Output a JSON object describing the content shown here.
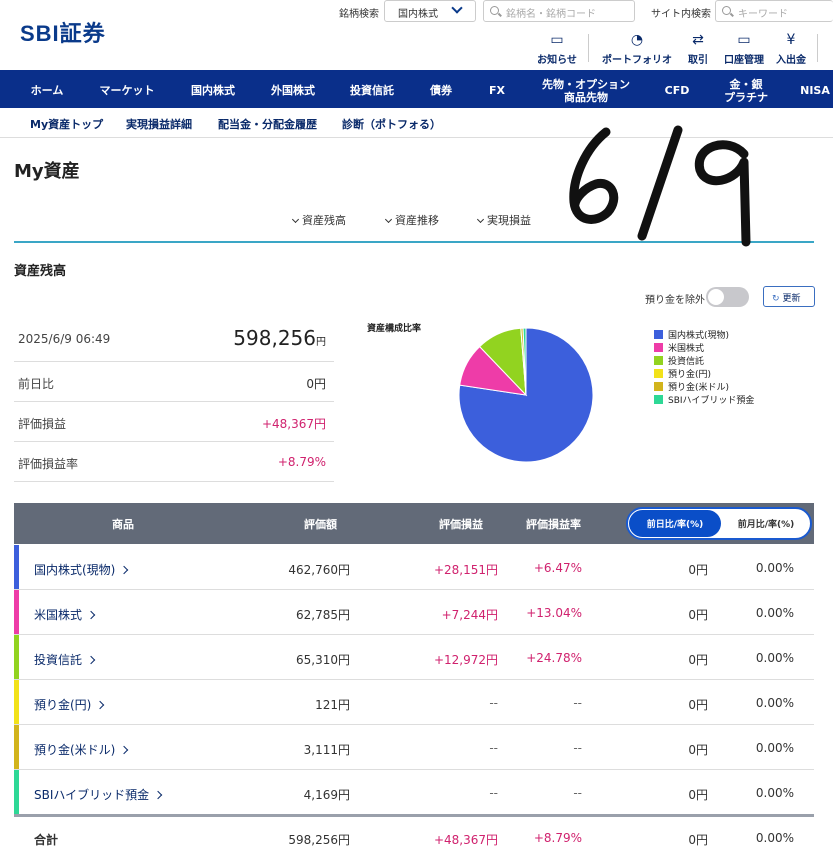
{
  "header": {
    "logo": "SBI証券",
    "ticker_search_label": "銘柄検索",
    "market_select": "国内株式",
    "ticker_placeholder": "銘柄名・銘柄コード",
    "site_search_label": "サイト内検索",
    "site_placeholder": "キーワード",
    "icons": [
      {
        "label": "お知らせ",
        "icon": "chat-icon"
      },
      {
        "label": "ポートフォリオ",
        "icon": "portfolio-icon"
      },
      {
        "label": "取引",
        "icon": "trade-icon"
      },
      {
        "label": "口座管理",
        "icon": "account-icon"
      },
      {
        "label": "入出金",
        "icon": "yen-icon"
      }
    ]
  },
  "nav": [
    "ホーム",
    "マーケット",
    "国内株式",
    "外国株式",
    "投資信託",
    "債券",
    "FX",
    "先物・オプション\n商品先物",
    "CFD",
    "金・銀\nプラチナ",
    "NISA"
  ],
  "subnav": [
    "My資産トップ",
    "実現損益詳細",
    "配当金・分配金履歴",
    "診断（ポトフォる）"
  ],
  "page_title": "My資産",
  "anchors": [
    "資産残高",
    "資産推移",
    "実現損益"
  ],
  "handwritten_note": "6/9",
  "balance": {
    "section_title": "資産残高",
    "toggle_label": "預り金を除外",
    "refresh_label": "更新",
    "datetime": "2025/6/9 06:49",
    "total": "598,256",
    "yen": "円",
    "rows": [
      {
        "label": "前日比",
        "value": "0円",
        "positive": false
      },
      {
        "label": "評価損益",
        "value": "+48,367円",
        "positive": true
      },
      {
        "label": "評価損益率",
        "value": "+8.79%",
        "positive": true
      }
    ]
  },
  "chart_data": {
    "type": "pie",
    "title": "資産構成比率",
    "categories": [
      "国内株式(現物)",
      "米国株式",
      "投資信託",
      "預り金(円)",
      "預り金(米ドル)",
      "SBIハイブリッド預金"
    ],
    "values": [
      462760,
      62785,
      65310,
      121,
      3111,
      4169
    ],
    "colors": [
      "#3c5fdc",
      "#ee3ca8",
      "#92d320",
      "#f2e21a",
      "#d2b41c",
      "#2ed896"
    ],
    "legend": "right"
  },
  "table": {
    "headers": [
      "商品",
      "評価額",
      "評価損益",
      "評価損益率"
    ],
    "toggle": [
      "前日比/率(%)",
      "前月比/率(%)"
    ],
    "rows": [
      {
        "name": "国内株式(現物)",
        "value": "462,760円",
        "pl": "+28,151円",
        "rate": "+6.47%",
        "diff": "0円",
        "diff_rate": "0.00%",
        "color": "#3c5fdc"
      },
      {
        "name": "米国株式",
        "value": "62,785円",
        "pl": "+7,244円",
        "rate": "+13.04%",
        "diff": "0円",
        "diff_rate": "0.00%",
        "color": "#ee3ca8"
      },
      {
        "name": "投資信託",
        "value": "65,310円",
        "pl": "+12,972円",
        "rate": "+24.78%",
        "diff": "0円",
        "diff_rate": "0.00%",
        "color": "#92d320"
      },
      {
        "name": "預り金(円)",
        "value": "121円",
        "pl": "--",
        "rate": "--",
        "diff": "0円",
        "diff_rate": "0.00%",
        "color": "#f2e21a"
      },
      {
        "name": "預り金(米ドル)",
        "value": "3,111円",
        "pl": "--",
        "rate": "--",
        "diff": "0円",
        "diff_rate": "0.00%",
        "color": "#d2b41c"
      },
      {
        "name": "SBIハイブリッド預金",
        "value": "4,169円",
        "pl": "--",
        "rate": "--",
        "diff": "0円",
        "diff_rate": "0.00%",
        "color": "#2ed896"
      }
    ],
    "total": {
      "name": "合計",
      "value": "598,256円",
      "pl": "+48,367円",
      "rate": "+8.79%",
      "diff": "0円",
      "diff_rate": "0.00%"
    }
  }
}
